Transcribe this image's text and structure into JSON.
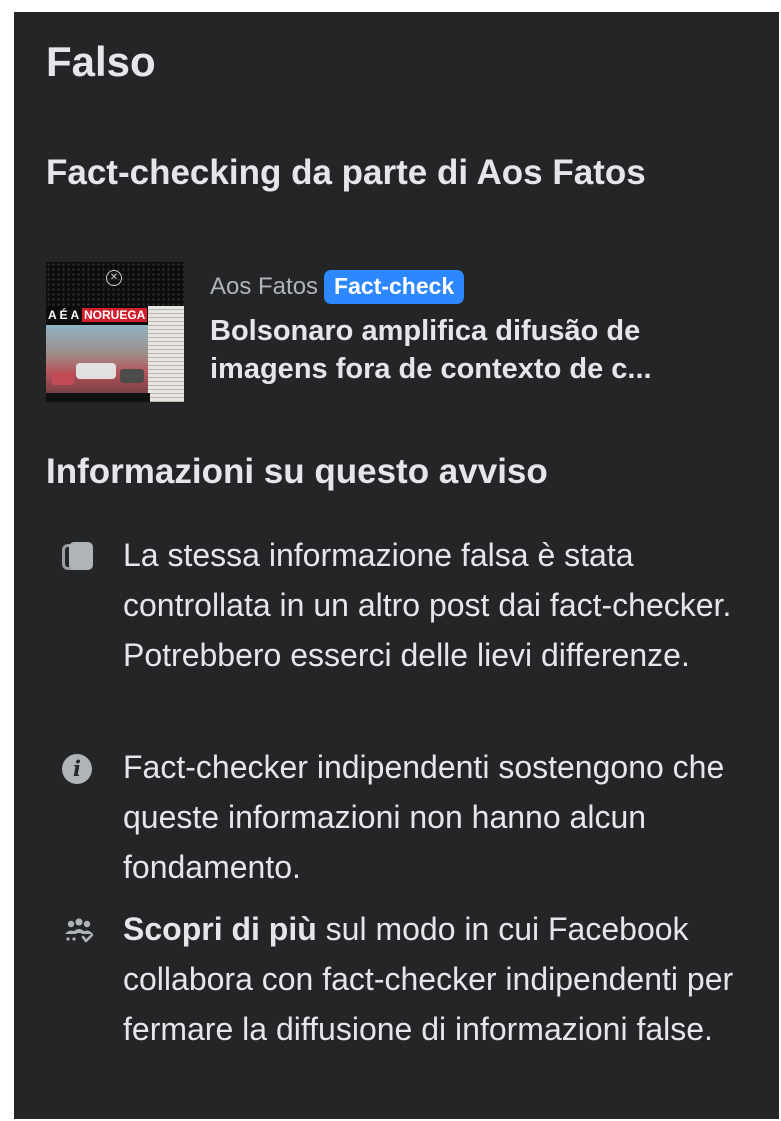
{
  "rating": {
    "label": "Falso"
  },
  "fact_check": {
    "title": "Fact-checking da parte di Aos Fatos",
    "article": {
      "source": "Aos Fatos",
      "badge": "Fact-check",
      "headline": "Bolsonaro amplifica difusão de imagens fora de contexto de c...",
      "thumbnail": {
        "headline_prefix": "A É A",
        "headline_highlight": "NORUEGA",
        "accent_color": "#d21f2b"
      }
    }
  },
  "about": {
    "title": "Informazioni su questo avviso",
    "items": [
      {
        "icon": "copy-icon",
        "text": "La stessa informazione falsa è stata controllata in un altro post dai fact-checker. Potrebbero esserci delle lievi differenze."
      },
      {
        "icon": "info-icon",
        "text": "Fact-checker indipendenti sostengono che queste informazioni non hanno alcun fondamento."
      },
      {
        "icon": "people-icon",
        "link_text": "Scopri di più",
        "text": " sul modo in cui Facebook collabora con fact-checker indipendenti per fermare la diffusione di informazioni false."
      }
    ]
  },
  "colors": {
    "background": "#242526",
    "primary_text": "#e4e6eb",
    "secondary_text": "#b0b3b8",
    "badge": "#2d88ff"
  }
}
